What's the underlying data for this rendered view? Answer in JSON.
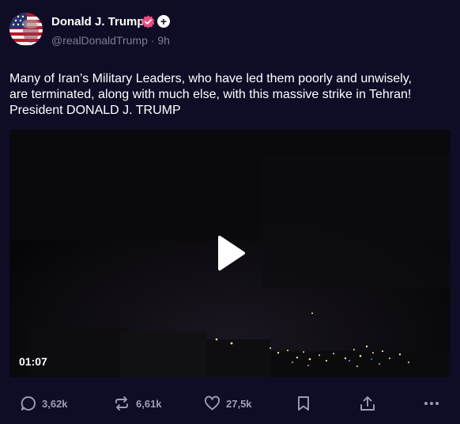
{
  "post": {
    "author_name": "Donald J. Trump",
    "handle": "@realDonaldTrump",
    "separator": "·",
    "time_ago": "9h",
    "text_lines": [
      "Many of Iran’s Military Leaders, who have led them poorly and unwisely,",
      "are terminated, along with much else, with this massive strike in Tehran!",
      "President DONALD J. TRUMP"
    ],
    "follow_symbol": "+"
  },
  "video": {
    "duration": "01:07"
  },
  "actions": {
    "replies": "3,62k",
    "reposts": "6,61k",
    "likes": "27,5k"
  },
  "icons": {
    "avatar": "avatar-american-flag",
    "verified": "verified-badge-icon",
    "follow": "plus-icon",
    "play": "play-icon",
    "reply": "comment-icon",
    "repost": "repost-icon",
    "like": "heart-icon",
    "bookmark": "bookmark-icon",
    "share": "share-icon",
    "more": "more-icon"
  },
  "colors": {
    "background": "#0f0d26",
    "secondary_text": "#7d7b95",
    "verified_badge": "#ec4b7e",
    "action_icons": "#9e9cb6"
  }
}
